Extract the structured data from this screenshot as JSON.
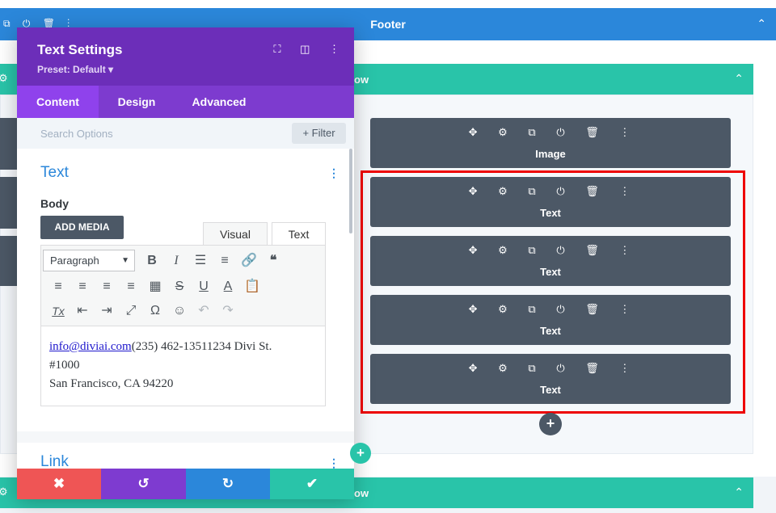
{
  "builder": {
    "section": {
      "title": "Footer",
      "toolbar_icons": "⧉ ⏻ 🗑 ⋮",
      "collapse_icon": "⌃"
    },
    "rows": [
      {
        "label": "ow",
        "collapse_icon": "⌃",
        "gear_icon": "⚙"
      },
      {
        "label": "ow",
        "collapse_icon": "⌃",
        "gear_icon": "⚙"
      }
    ],
    "module_toolbar_icons": "✥ ⚙ ⧉ ⏻ 🗑 ⋮",
    "modules": [
      {
        "label": "Image"
      },
      {
        "label": "Text"
      },
      {
        "label": "Text"
      },
      {
        "label": "Text"
      },
      {
        "label": "Text"
      }
    ],
    "add_module_icon": "+",
    "add_row_icon": "+"
  },
  "modal": {
    "title": "Text Settings",
    "preset": "Preset: Default ▾",
    "header_icons": {
      "fullscreen": "⛶",
      "split": "◫",
      "more": "⋮"
    },
    "tabs": [
      {
        "label": "Content",
        "active": true
      },
      {
        "label": "Design",
        "active": false
      },
      {
        "label": "Advanced",
        "active": false
      }
    ],
    "search_placeholder": "Search Options",
    "filter_label": "+ Filter",
    "text_group": {
      "title": "Text",
      "menu_icon": "⋮",
      "body_label": "Body",
      "add_media_label": "ADD MEDIA",
      "editor_tabs": {
        "visual": "Visual",
        "text": "Text"
      },
      "format_select": "Paragraph",
      "toolbar_row1": [
        "B",
        "I",
        "☰",
        "≡",
        "🔗",
        "❝"
      ],
      "toolbar_row2": [
        "≡",
        "≡",
        "≡",
        "≡",
        "▦",
        "S",
        "U",
        "A",
        "📋"
      ],
      "toolbar_row3": [
        "Tx",
        "⇤",
        "⇥",
        "⤢",
        "Ω",
        "☺",
        "↶",
        "↷"
      ],
      "content": {
        "email": "info@diviai.com",
        "line1_rest": "(235) 462-13511234 Divi St.",
        "line2": "#1000",
        "line3": "San Francisco, CA 94220"
      }
    },
    "link_group": {
      "title": "Link",
      "menu_icon": "⋮"
    },
    "footer": {
      "close_icon": "✖",
      "undo_icon": "↺",
      "redo_icon": "↻",
      "save_icon": "✔"
    },
    "colors": {
      "header": "#6c2eb9",
      "tab_active": "#8f42ec",
      "close": "#ef5555",
      "undo": "#7e3bd0",
      "redo": "#2b87da",
      "save": "#29c4a9"
    }
  }
}
